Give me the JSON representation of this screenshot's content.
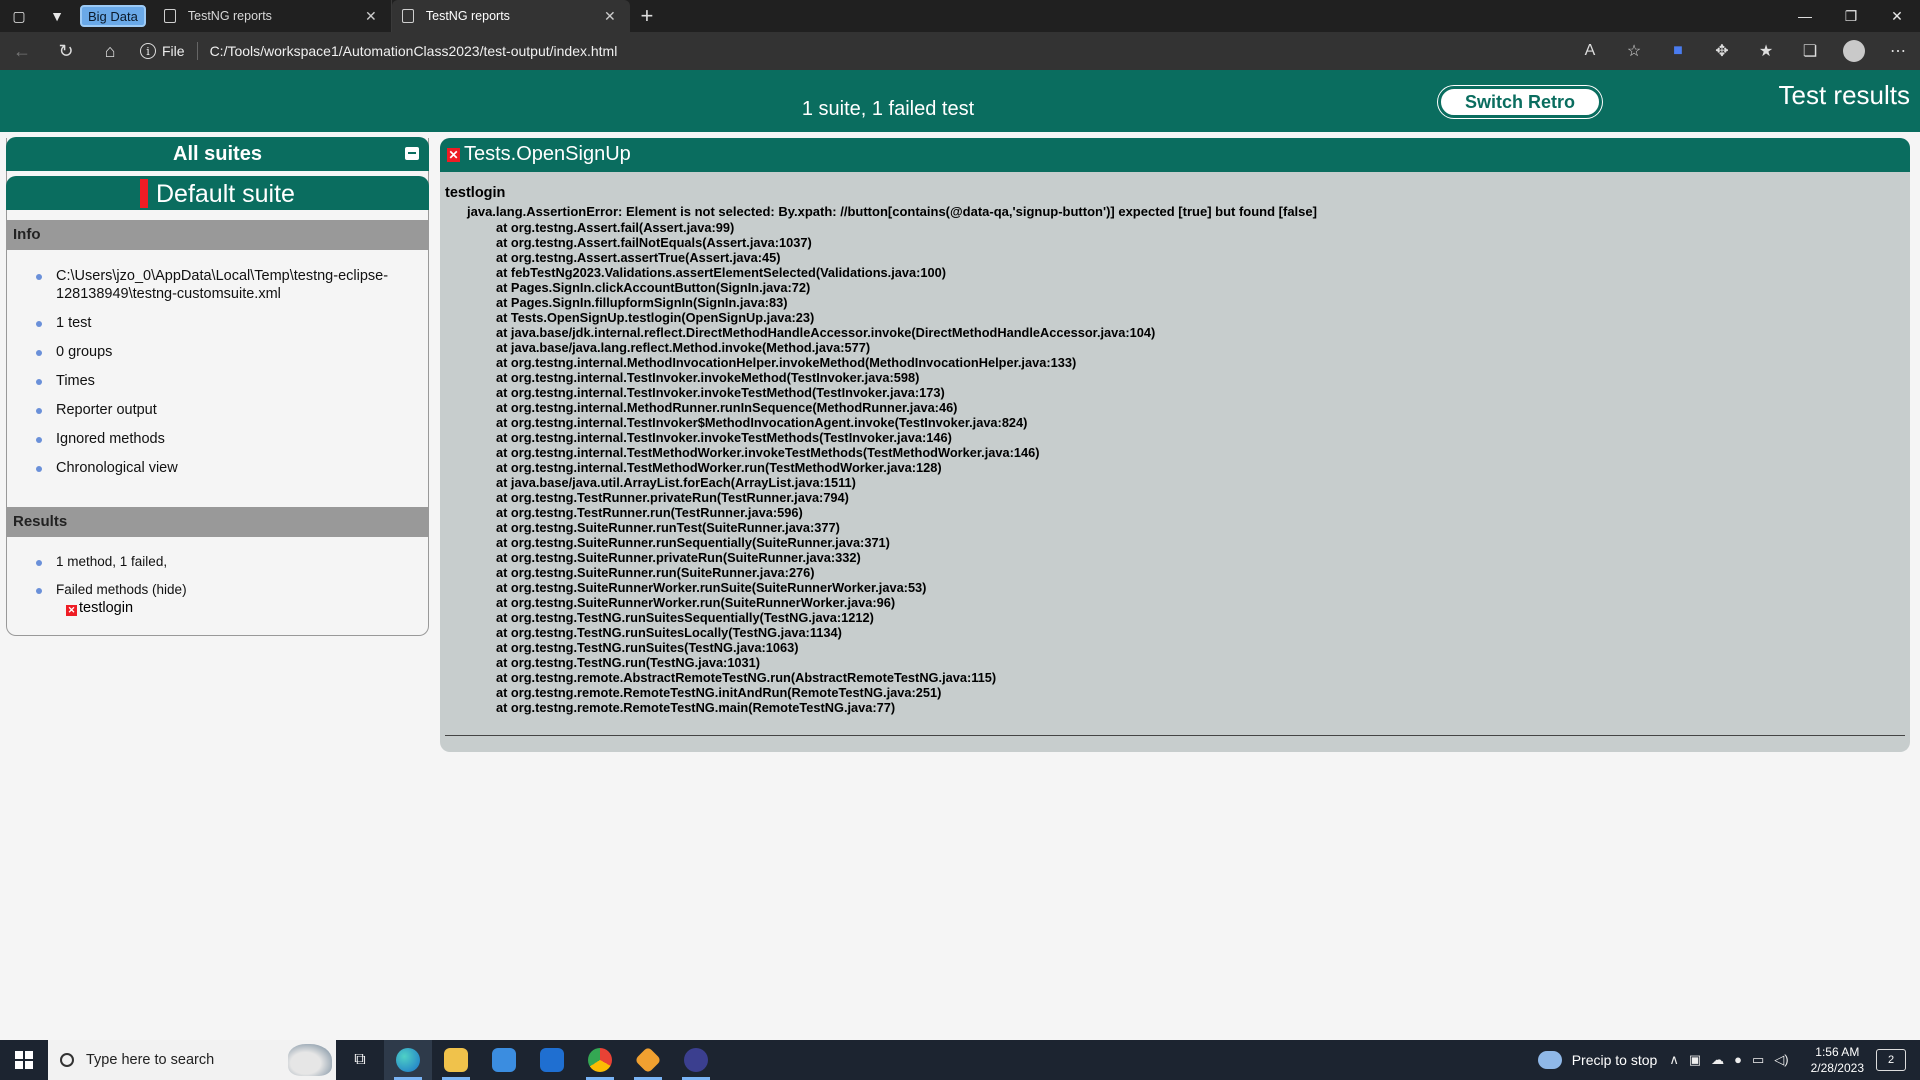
{
  "browser": {
    "tab_group_label": "Big Data",
    "tabs": [
      {
        "title": "TestNG reports",
        "active": false
      },
      {
        "title": "TestNG reports",
        "active": true
      }
    ],
    "address": {
      "scheme_label": "File",
      "url": "C:/Tools/workspace1/AutomationClass2023/test-output/index.html"
    }
  },
  "banner": {
    "summary": "1 suite, 1 failed test",
    "switch_button": "Switch Retro",
    "title": "Test results"
  },
  "left": {
    "header": "All suites",
    "suite_name": "Default suite",
    "info_heading": "Info",
    "info_items": [
      "C:\\Users\\jzo_0\\AppData\\Local\\Temp\\testng-eclipse-128138949\\testng-customsuite.xml",
      "1 test",
      "0 groups",
      "Times",
      "Reporter output",
      "Ignored methods",
      "Chronological view"
    ],
    "results_heading": "Results",
    "results_summary": "1 method, 1 failed,",
    "failed_methods_label": "Failed methods (hide)",
    "failed_method": "testlogin"
  },
  "main": {
    "class_title": "Tests.OpenSignUp",
    "method": "testlogin",
    "exception": "java.lang.AssertionError: Element is not selected: By.xpath: //button[contains(@data-qa,'signup-button')] expected [true] but found [false]",
    "stack": [
      "at org.testng.Assert.fail(Assert.java:99)",
      "at org.testng.Assert.failNotEquals(Assert.java:1037)",
      "at org.testng.Assert.assertTrue(Assert.java:45)",
      "at febTestNg2023.Validations.assertElementSelected(Validations.java:100)",
      "at Pages.SignIn.clickAccountButton(SignIn.java:72)",
      "at Pages.SignIn.fillupformSignIn(SignIn.java:83)",
      "at Tests.OpenSignUp.testlogin(OpenSignUp.java:23)",
      "at java.base/jdk.internal.reflect.DirectMethodHandleAccessor.invoke(DirectMethodHandleAccessor.java:104)",
      "at java.base/java.lang.reflect.Method.invoke(Method.java:577)",
      "at org.testng.internal.MethodInvocationHelper.invokeMethod(MethodInvocationHelper.java:133)",
      "at org.testng.internal.TestInvoker.invokeMethod(TestInvoker.java:598)",
      "at org.testng.internal.TestInvoker.invokeTestMethod(TestInvoker.java:173)",
      "at org.testng.internal.MethodRunner.runInSequence(MethodRunner.java:46)",
      "at org.testng.internal.TestInvoker$MethodInvocationAgent.invoke(TestInvoker.java:824)",
      "at org.testng.internal.TestInvoker.invokeTestMethods(TestInvoker.java:146)",
      "at org.testng.internal.TestMethodWorker.invokeTestMethods(TestMethodWorker.java:146)",
      "at org.testng.internal.TestMethodWorker.run(TestMethodWorker.java:128)",
      "at java.base/java.util.ArrayList.forEach(ArrayList.java:1511)",
      "at org.testng.TestRunner.privateRun(TestRunner.java:794)",
      "at org.testng.TestRunner.run(TestRunner.java:596)",
      "at org.testng.SuiteRunner.runTest(SuiteRunner.java:377)",
      "at org.testng.SuiteRunner.runSequentially(SuiteRunner.java:371)",
      "at org.testng.SuiteRunner.privateRun(SuiteRunner.java:332)",
      "at org.testng.SuiteRunner.run(SuiteRunner.java:276)",
      "at org.testng.SuiteRunnerWorker.runSuite(SuiteRunnerWorker.java:53)",
      "at org.testng.SuiteRunnerWorker.run(SuiteRunnerWorker.java:96)",
      "at org.testng.TestNG.runSuitesSequentially(TestNG.java:1212)",
      "at org.testng.TestNG.runSuitesLocally(TestNG.java:1134)",
      "at org.testng.TestNG.runSuites(TestNG.java:1063)",
      "at org.testng.TestNG.run(TestNG.java:1031)",
      "at org.testng.remote.AbstractRemoteTestNG.run(AbstractRemoteTestNG.java:115)",
      "at org.testng.remote.RemoteTestNG.initAndRun(RemoteTestNG.java:251)",
      "at org.testng.remote.RemoteTestNG.main(RemoteTestNG.java:77)"
    ]
  },
  "taskbar": {
    "search_placeholder": "Type here to search",
    "weather": "Precip to stop",
    "time": "1:56 AM",
    "date": "2/28/2023",
    "notification_count": "2"
  },
  "colors": {
    "header_green": "#0a6d5f",
    "fail_red": "#ee1c24",
    "panel_gray": "#c7cdcd"
  }
}
